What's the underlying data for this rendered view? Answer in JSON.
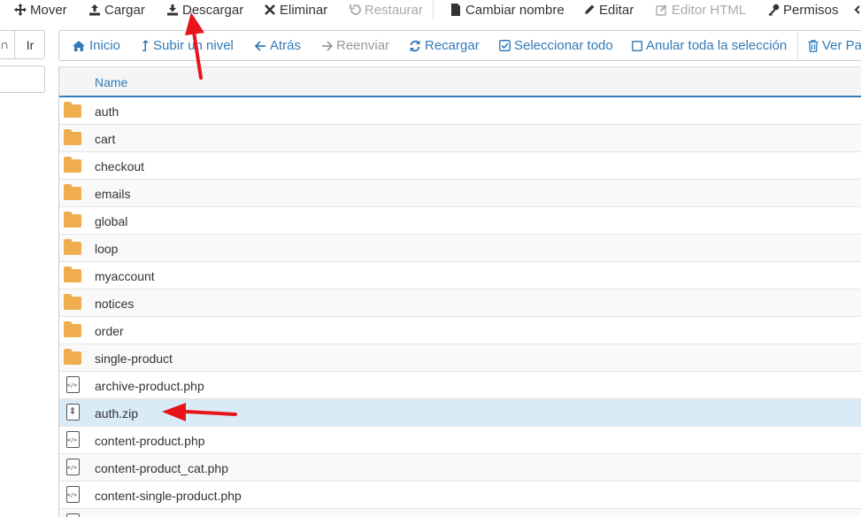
{
  "toolbar": {
    "mover": "Mover",
    "cargar": "Cargar",
    "descargar": "Descargar",
    "eliminar": "Eliminar",
    "restaurar": "Restaurar",
    "cambiar_nombre": "Cambiar nombre",
    "editar": "Editar",
    "editor_html": "Editor HTML",
    "permisos": "Permisos"
  },
  "left": {
    "cut_text": "∩",
    "go_label": "Ir"
  },
  "nav": {
    "inicio": "Inicio",
    "subir_nivel": "Subir un nivel",
    "atras": "Atrás",
    "reenviar": "Reenviar",
    "recargar": "Recargar",
    "seleccionar_todo": "Seleccionar todo",
    "anular_seleccion": "Anular toda la selección",
    "ver_papelera": "Ver Papelera"
  },
  "table": {
    "header_name": "Name",
    "rows": [
      {
        "name": "auth",
        "type": "folder"
      },
      {
        "name": "cart",
        "type": "folder"
      },
      {
        "name": "checkout",
        "type": "folder"
      },
      {
        "name": "emails",
        "type": "folder"
      },
      {
        "name": "global",
        "type": "folder"
      },
      {
        "name": "loop",
        "type": "folder"
      },
      {
        "name": "myaccount",
        "type": "folder"
      },
      {
        "name": "notices",
        "type": "folder"
      },
      {
        "name": "order",
        "type": "folder"
      },
      {
        "name": "single-product",
        "type": "folder"
      },
      {
        "name": "archive-product.php",
        "type": "code"
      },
      {
        "name": "auth.zip",
        "type": "zip",
        "selected": true
      },
      {
        "name": "content-product.php",
        "type": "code"
      },
      {
        "name": "content-product_cat.php",
        "type": "code"
      },
      {
        "name": "content-single-product.php",
        "type": "code"
      },
      {
        "name": "",
        "type": "code"
      }
    ]
  },
  "colors": {
    "link": "#337ab7",
    "folder": "#f0ad4e",
    "selected_row": "#d9ebf7",
    "annotation_arrow": "#e8141b"
  },
  "icons": {
    "mover": "arrows-move-icon",
    "cargar": "upload-icon",
    "descargar": "download-icon",
    "eliminar": "x-icon",
    "restaurar": "undo-icon",
    "cambiar_nombre": "file-icon",
    "editar": "pencil-icon",
    "editor_html": "edit-box-icon",
    "permisos": "key-icon"
  }
}
